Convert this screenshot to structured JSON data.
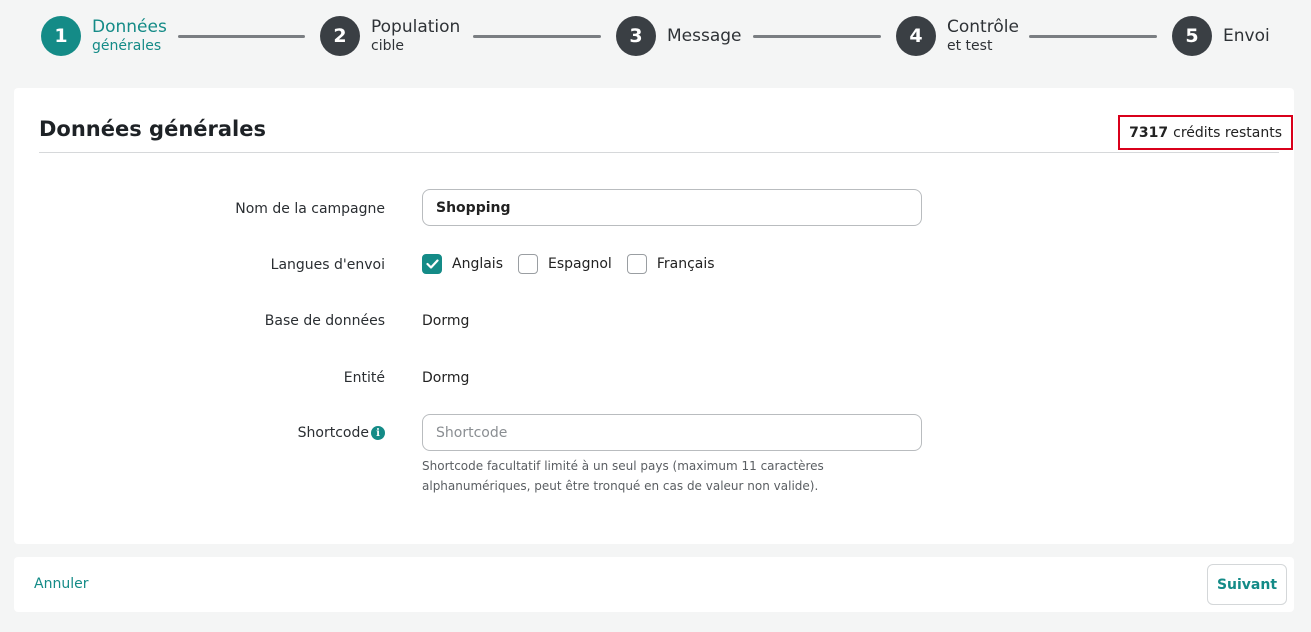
{
  "stepper": {
    "steps": [
      {
        "number": "1",
        "label": "Données",
        "sub": "générales"
      },
      {
        "number": "2",
        "label": "Population",
        "sub": "cible"
      },
      {
        "number": "3",
        "label": "Message",
        "sub": ""
      },
      {
        "number": "4",
        "label": "Contrôle",
        "sub": "et test"
      },
      {
        "number": "5",
        "label": "Envoi",
        "sub": ""
      }
    ],
    "active_step": 1,
    "active_color": "#148b87",
    "inactive_color": "#3a3f44"
  },
  "card": {
    "title": "Données générales",
    "credits": {
      "count": "7317",
      "suffix": "crédits restants"
    }
  },
  "form": {
    "campaign_name": {
      "label": "Nom de la campagne",
      "value": "Shopping"
    },
    "languages": {
      "label": "Langues d'envoi",
      "options": [
        {
          "label": "Anglais",
          "checked": true
        },
        {
          "label": "Espagnol",
          "checked": false
        },
        {
          "label": "Français",
          "checked": false
        }
      ]
    },
    "database": {
      "label": "Base de données",
      "value": "Dormg"
    },
    "entity": {
      "label": "Entité",
      "value": "Dormg"
    },
    "shortcode": {
      "label": "Shortcode",
      "info_icon": "info-icon",
      "value": "",
      "placeholder": "Shortcode",
      "help": "Shortcode facultatif limité à un seul pays (maximum 11 caractères alphanumériques, peut être tronqué en cas de valeur non valide)."
    }
  },
  "footer": {
    "cancel_label": "Annuler",
    "next_label": "Suivant"
  },
  "colors": {
    "accent": "#148b87",
    "highlight_border": "#d9001b",
    "background": "#f4f5f5"
  }
}
